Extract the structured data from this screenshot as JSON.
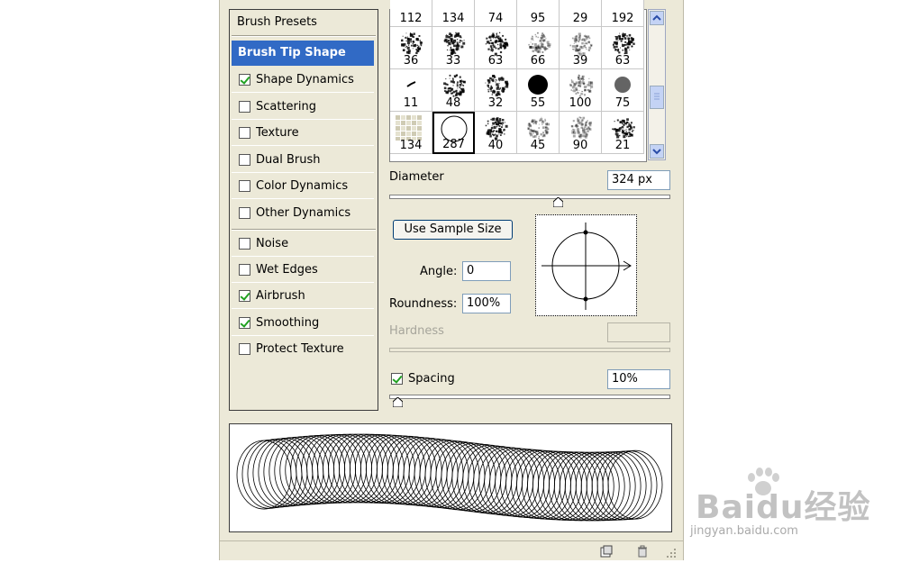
{
  "sidebar": {
    "presets_label": "Brush Presets",
    "items": [
      {
        "label": "Brush Tip Shape",
        "checkbox": false,
        "checked": false,
        "selected": true
      },
      {
        "label": "Shape Dynamics",
        "checkbox": true,
        "checked": true
      },
      {
        "label": "Scattering",
        "checkbox": true,
        "checked": false
      },
      {
        "label": "Texture",
        "checkbox": true,
        "checked": false
      },
      {
        "label": "Dual Brush",
        "checkbox": true,
        "checked": false
      },
      {
        "label": "Color Dynamics",
        "checkbox": true,
        "checked": false
      },
      {
        "label": "Other Dynamics",
        "checkbox": true,
        "checked": false
      },
      {
        "label": "Noise",
        "checkbox": true,
        "checked": false
      },
      {
        "label": "Wet Edges",
        "checkbox": true,
        "checked": false
      },
      {
        "label": "Airbrush",
        "checkbox": true,
        "checked": true
      },
      {
        "label": "Smoothing",
        "checkbox": true,
        "checked": true
      },
      {
        "label": "Protect Texture",
        "checkbox": true,
        "checked": false
      }
    ]
  },
  "brush_grid": {
    "rows": [
      [
        "112",
        "134",
        "74",
        "95",
        "29",
        "192"
      ],
      [
        "36",
        "33",
        "63",
        "66",
        "39",
        "63"
      ],
      [
        "11",
        "48",
        "32",
        "55",
        "100",
        "75"
      ],
      [
        "134",
        "287",
        "40",
        "45",
        "90",
        "21"
      ]
    ],
    "selected": "287"
  },
  "diameter": {
    "label": "Diameter",
    "value": "324 px",
    "slider": 0.6
  },
  "use_sample_size": "Use Sample Size",
  "angle": {
    "label": "Angle:",
    "value": "0"
  },
  "roundness": {
    "label": "Roundness:",
    "value": "100%"
  },
  "hardness": {
    "label": "Hardness",
    "value": ""
  },
  "spacing": {
    "label": "Spacing",
    "value": "10%",
    "checked": true,
    "slider": 0.03
  },
  "watermark": {
    "brand": "Baidu经验",
    "url": "jingyan.baidu.com"
  },
  "colors": {
    "selection": "#316ac5",
    "panel": "#ece9d8",
    "check": "#21a121"
  }
}
